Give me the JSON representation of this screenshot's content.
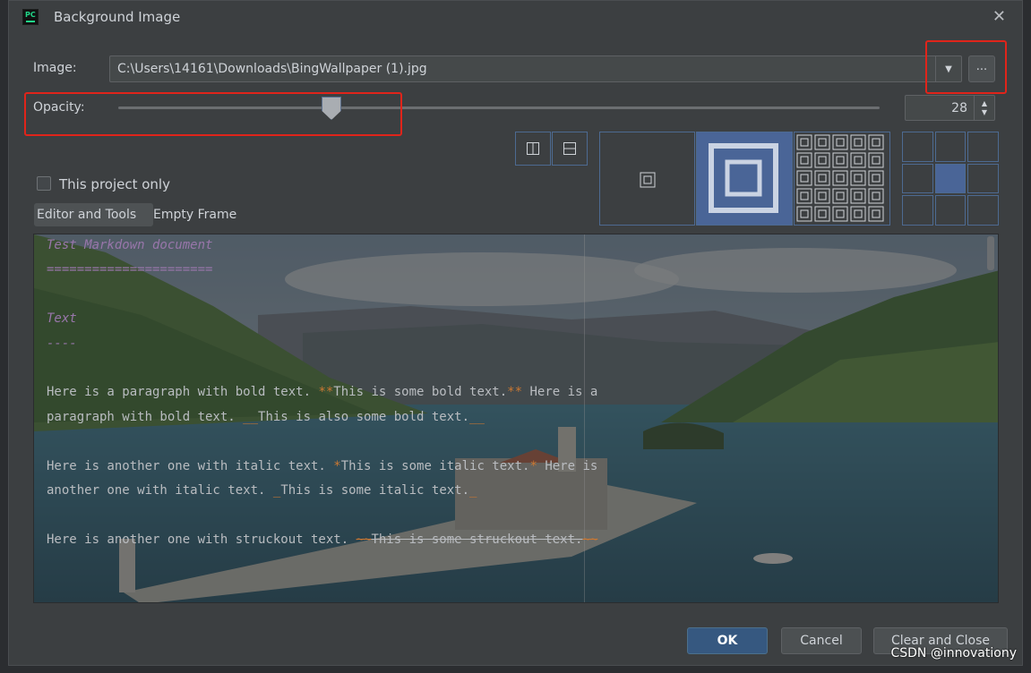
{
  "dialog": {
    "title": "Background Image",
    "close_icon": "close-icon"
  },
  "image": {
    "label": "Image:",
    "path": "C:\\Users\\14161\\Downloads\\BingWallpaper (1).jpg",
    "browse_label": "..."
  },
  "opacity": {
    "label": "Opacity:",
    "value": "28",
    "slider_fraction": 0.28
  },
  "options": {
    "project_only_label": "This project only",
    "project_only_checked": false,
    "tabs": [
      "Editor and Tools",
      "Empty Frame"
    ],
    "active_tab": "Editor and Tools",
    "fill_modes": [
      "plain",
      "scale",
      "tile"
    ],
    "selected_fill_mode": "scale",
    "anchor_selected": "center"
  },
  "preview": {
    "lines": [
      {
        "type": "head",
        "text": "Test Markdown document"
      },
      {
        "type": "head",
        "text": "======================"
      },
      {
        "type": "blank",
        "text": ""
      },
      {
        "type": "head",
        "text": "Text"
      },
      {
        "type": "head",
        "text": "----"
      },
      {
        "type": "blank",
        "text": ""
      },
      {
        "type": "text",
        "parts": [
          [
            "Here is a paragraph with bold text. ",
            ""
          ],
          [
            "**",
            "op"
          ],
          [
            "This is some bold text.",
            ""
          ],
          [
            "**",
            "op"
          ],
          [
            " Here is a",
            ""
          ]
        ]
      },
      {
        "type": "text",
        "parts": [
          [
            "paragraph with bold text. ",
            ""
          ],
          [
            "__",
            "op"
          ],
          [
            "This is also some bold text.",
            ""
          ],
          [
            "__",
            "op"
          ]
        ]
      },
      {
        "type": "blank",
        "text": ""
      },
      {
        "type": "text",
        "parts": [
          [
            "Here is another one with italic text. ",
            ""
          ],
          [
            "*",
            "op"
          ],
          [
            "This is some italic text.",
            ""
          ],
          [
            "*",
            "op"
          ],
          [
            " Here is",
            ""
          ]
        ]
      },
      {
        "type": "text",
        "parts": [
          [
            "another one with italic text. ",
            ""
          ],
          [
            "_",
            "op"
          ],
          [
            "This is some italic text.",
            ""
          ],
          [
            "_",
            "op"
          ]
        ]
      },
      {
        "type": "blank",
        "text": ""
      },
      {
        "type": "text",
        "parts": [
          [
            "Here is another one with struckout text. ",
            ""
          ],
          [
            "~~",
            "opstrike"
          ],
          [
            "This is some struckout text.",
            "strike"
          ],
          [
            "~~",
            "opstrike"
          ]
        ]
      }
    ]
  },
  "buttons": {
    "ok": "OK",
    "cancel": "Cancel",
    "clear_close": "Clear and Close"
  },
  "watermark": "CSDN @innovationy",
  "colors": {
    "accent": "#365880",
    "highlight": "#e0241a",
    "markdown_heading": "#9876aa",
    "markdown_operator": "#cc7832"
  }
}
